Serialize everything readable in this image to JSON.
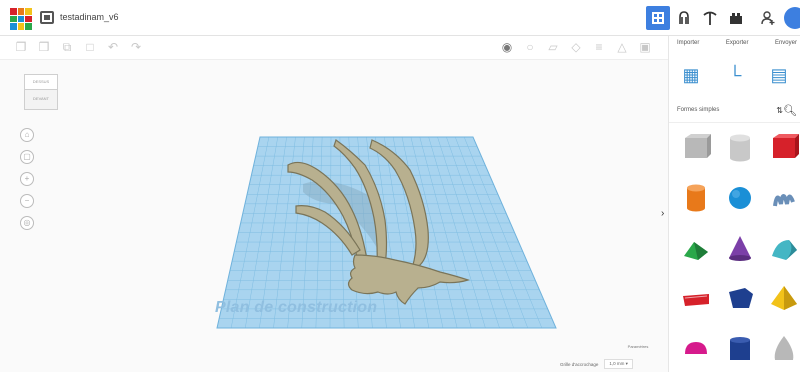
{
  "app": {
    "title": "testadinam_v6"
  },
  "header_buttons": [
    {
      "name": "grid-view-icon",
      "glyph": "",
      "active": true
    },
    {
      "name": "gripper-icon",
      "glyph": "♥"
    },
    {
      "name": "pickaxe-icon",
      "glyph": "⚒"
    },
    {
      "name": "bricks-icon",
      "glyph": "▲"
    },
    {
      "name": "user-add-icon",
      "glyph": "☺"
    }
  ],
  "panel": {
    "import_label": "Importer",
    "export_label": "Exporter",
    "send_label": "Envoyer",
    "shape_category": "Formes simples",
    "shapes": [
      {
        "name": "box-striped",
        "color": "#b8b8b8"
      },
      {
        "name": "cylinder-striped",
        "color": "#c8c8c8"
      },
      {
        "name": "box",
        "color": "#d6212a"
      },
      {
        "name": "cylinder",
        "color": "#e8791a"
      },
      {
        "name": "sphere",
        "color": "#1a8fd6"
      },
      {
        "name": "scribble",
        "color": "#6a8fb8"
      },
      {
        "name": "roof",
        "color": "#2aa84a"
      },
      {
        "name": "cone",
        "color": "#7b3fa8"
      },
      {
        "name": "round-roof",
        "color": "#44b6c4"
      },
      {
        "name": "text",
        "color": "#d6212a"
      },
      {
        "name": "polygon",
        "color": "#1e3f8f"
      },
      {
        "name": "pyramid",
        "color": "#f2c21a"
      },
      {
        "name": "half-sphere",
        "color": "#d61a8c"
      },
      {
        "name": "hexagonal-prism",
        "color": "#1e3f8f"
      },
      {
        "name": "paraboloid",
        "color": "#b8b8b8"
      }
    ]
  },
  "viewport": {
    "view_cube_top": "DESSUS",
    "view_cube_front": "DEVANT",
    "workplane_label": "Plan de construction",
    "params_label": "Paramètres",
    "snap_label": "Grille d'accrochage",
    "snap_value": "1,0 mm",
    "snap_arrow": "▾"
  },
  "colors": {
    "workplane": "#a9d4ef",
    "grid_line": "#7fbde2",
    "model_fill": "#b8b08f",
    "model_edge": "#7a7458",
    "accent": "#3d7fe0"
  }
}
